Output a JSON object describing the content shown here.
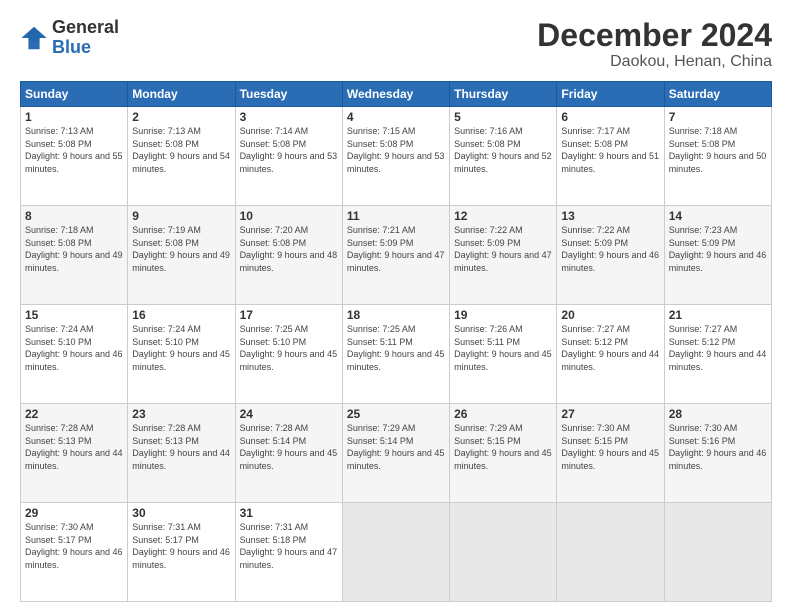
{
  "header": {
    "logo_line1": "General",
    "logo_line2": "Blue",
    "title": "December 2024",
    "subtitle": "Daokou, Henan, China"
  },
  "weekdays": [
    "Sunday",
    "Monday",
    "Tuesday",
    "Wednesday",
    "Thursday",
    "Friday",
    "Saturday"
  ],
  "weeks": [
    [
      {
        "day": "1",
        "sunrise": "Sunrise: 7:13 AM",
        "sunset": "Sunset: 5:08 PM",
        "daylight": "Daylight: 9 hours and 55 minutes."
      },
      {
        "day": "2",
        "sunrise": "Sunrise: 7:13 AM",
        "sunset": "Sunset: 5:08 PM",
        "daylight": "Daylight: 9 hours and 54 minutes."
      },
      {
        "day": "3",
        "sunrise": "Sunrise: 7:14 AM",
        "sunset": "Sunset: 5:08 PM",
        "daylight": "Daylight: 9 hours and 53 minutes."
      },
      {
        "day": "4",
        "sunrise": "Sunrise: 7:15 AM",
        "sunset": "Sunset: 5:08 PM",
        "daylight": "Daylight: 9 hours and 53 minutes."
      },
      {
        "day": "5",
        "sunrise": "Sunrise: 7:16 AM",
        "sunset": "Sunset: 5:08 PM",
        "daylight": "Daylight: 9 hours and 52 minutes."
      },
      {
        "day": "6",
        "sunrise": "Sunrise: 7:17 AM",
        "sunset": "Sunset: 5:08 PM",
        "daylight": "Daylight: 9 hours and 51 minutes."
      },
      {
        "day": "7",
        "sunrise": "Sunrise: 7:18 AM",
        "sunset": "Sunset: 5:08 PM",
        "daylight": "Daylight: 9 hours and 50 minutes."
      }
    ],
    [
      {
        "day": "8",
        "sunrise": "Sunrise: 7:18 AM",
        "sunset": "Sunset: 5:08 PM",
        "daylight": "Daylight: 9 hours and 49 minutes."
      },
      {
        "day": "9",
        "sunrise": "Sunrise: 7:19 AM",
        "sunset": "Sunset: 5:08 PM",
        "daylight": "Daylight: 9 hours and 49 minutes."
      },
      {
        "day": "10",
        "sunrise": "Sunrise: 7:20 AM",
        "sunset": "Sunset: 5:08 PM",
        "daylight": "Daylight: 9 hours and 48 minutes."
      },
      {
        "day": "11",
        "sunrise": "Sunrise: 7:21 AM",
        "sunset": "Sunset: 5:09 PM",
        "daylight": "Daylight: 9 hours and 47 minutes."
      },
      {
        "day": "12",
        "sunrise": "Sunrise: 7:22 AM",
        "sunset": "Sunset: 5:09 PM",
        "daylight": "Daylight: 9 hours and 47 minutes."
      },
      {
        "day": "13",
        "sunrise": "Sunrise: 7:22 AM",
        "sunset": "Sunset: 5:09 PM",
        "daylight": "Daylight: 9 hours and 46 minutes."
      },
      {
        "day": "14",
        "sunrise": "Sunrise: 7:23 AM",
        "sunset": "Sunset: 5:09 PM",
        "daylight": "Daylight: 9 hours and 46 minutes."
      }
    ],
    [
      {
        "day": "15",
        "sunrise": "Sunrise: 7:24 AM",
        "sunset": "Sunset: 5:10 PM",
        "daylight": "Daylight: 9 hours and 46 minutes."
      },
      {
        "day": "16",
        "sunrise": "Sunrise: 7:24 AM",
        "sunset": "Sunset: 5:10 PM",
        "daylight": "Daylight: 9 hours and 45 minutes."
      },
      {
        "day": "17",
        "sunrise": "Sunrise: 7:25 AM",
        "sunset": "Sunset: 5:10 PM",
        "daylight": "Daylight: 9 hours and 45 minutes."
      },
      {
        "day": "18",
        "sunrise": "Sunrise: 7:25 AM",
        "sunset": "Sunset: 5:11 PM",
        "daylight": "Daylight: 9 hours and 45 minutes."
      },
      {
        "day": "19",
        "sunrise": "Sunrise: 7:26 AM",
        "sunset": "Sunset: 5:11 PM",
        "daylight": "Daylight: 9 hours and 45 minutes."
      },
      {
        "day": "20",
        "sunrise": "Sunrise: 7:27 AM",
        "sunset": "Sunset: 5:12 PM",
        "daylight": "Daylight: 9 hours and 44 minutes."
      },
      {
        "day": "21",
        "sunrise": "Sunrise: 7:27 AM",
        "sunset": "Sunset: 5:12 PM",
        "daylight": "Daylight: 9 hours and 44 minutes."
      }
    ],
    [
      {
        "day": "22",
        "sunrise": "Sunrise: 7:28 AM",
        "sunset": "Sunset: 5:13 PM",
        "daylight": "Daylight: 9 hours and 44 minutes."
      },
      {
        "day": "23",
        "sunrise": "Sunrise: 7:28 AM",
        "sunset": "Sunset: 5:13 PM",
        "daylight": "Daylight: 9 hours and 44 minutes."
      },
      {
        "day": "24",
        "sunrise": "Sunrise: 7:28 AM",
        "sunset": "Sunset: 5:14 PM",
        "daylight": "Daylight: 9 hours and 45 minutes."
      },
      {
        "day": "25",
        "sunrise": "Sunrise: 7:29 AM",
        "sunset": "Sunset: 5:14 PM",
        "daylight": "Daylight: 9 hours and 45 minutes."
      },
      {
        "day": "26",
        "sunrise": "Sunrise: 7:29 AM",
        "sunset": "Sunset: 5:15 PM",
        "daylight": "Daylight: 9 hours and 45 minutes."
      },
      {
        "day": "27",
        "sunrise": "Sunrise: 7:30 AM",
        "sunset": "Sunset: 5:15 PM",
        "daylight": "Daylight: 9 hours and 45 minutes."
      },
      {
        "day": "28",
        "sunrise": "Sunrise: 7:30 AM",
        "sunset": "Sunset: 5:16 PM",
        "daylight": "Daylight: 9 hours and 46 minutes."
      }
    ],
    [
      {
        "day": "29",
        "sunrise": "Sunrise: 7:30 AM",
        "sunset": "Sunset: 5:17 PM",
        "daylight": "Daylight: 9 hours and 46 minutes."
      },
      {
        "day": "30",
        "sunrise": "Sunrise: 7:31 AM",
        "sunset": "Sunset: 5:17 PM",
        "daylight": "Daylight: 9 hours and 46 minutes."
      },
      {
        "day": "31",
        "sunrise": "Sunrise: 7:31 AM",
        "sunset": "Sunset: 5:18 PM",
        "daylight": "Daylight: 9 hours and 47 minutes."
      },
      null,
      null,
      null,
      null
    ]
  ]
}
